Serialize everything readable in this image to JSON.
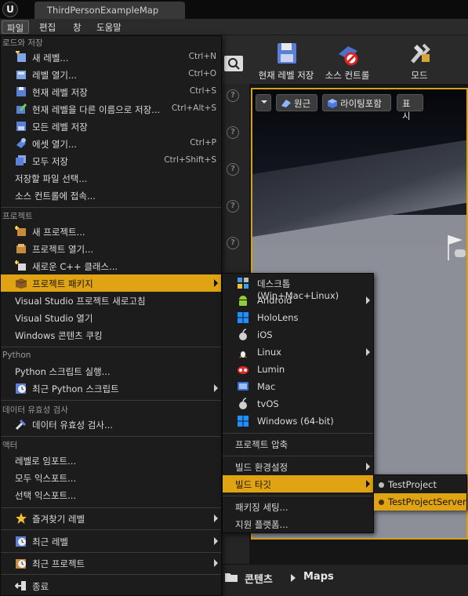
{
  "window": {
    "logo": "U",
    "tab_title": "ThirdPersonExampleMap"
  },
  "menubar": {
    "items": [
      "파일",
      "편집",
      "창",
      "도움말"
    ]
  },
  "toolbar": {
    "save_current_level": "현재 레벨 저장",
    "source_control": "소스 컨트롤",
    "modes": "모드"
  },
  "viewport_bar": {
    "perspective": "원근",
    "lit": "라이팅포함",
    "show": "표시"
  },
  "content_browser": {
    "content": "콘텐츠",
    "maps": "Maps"
  },
  "file_menu": {
    "sections": {
      "load_save": "로드와 저장",
      "project": "프로젝트",
      "python": "Python",
      "data_validation": "데이터 유효성 검사",
      "actor": "액터"
    },
    "items": {
      "new_level": {
        "label": "새 레벨...",
        "shortcut": "Ctrl+N"
      },
      "open_level": {
        "label": "레벨 열기...",
        "shortcut": "Ctrl+O"
      },
      "save_current": {
        "label": "현재 레벨 저장",
        "shortcut": "Ctrl+S"
      },
      "save_current_as": {
        "label": "현재 레벨을 다른 이름으로 저장...",
        "shortcut": "Ctrl+Alt+S"
      },
      "save_all_levels": {
        "label": "모든 레벨 저장"
      },
      "open_asset": {
        "label": "에셋 열기...",
        "shortcut": "Ctrl+P"
      },
      "save_all": {
        "label": "모두 저장",
        "shortcut": "Ctrl+Shift+S"
      },
      "choose_files_to_save": {
        "label": "저장할 파일 선택..."
      },
      "connect_source_control": {
        "label": "소스 컨트롤에 접속..."
      },
      "new_project": {
        "label": "새 프로젝트..."
      },
      "open_project": {
        "label": "프로젝트 열기..."
      },
      "new_cpp_class": {
        "label": "새로운 C++ 클래스..."
      },
      "package_project": {
        "label": "프로젝트 패키지"
      },
      "refresh_vs": {
        "label": "Visual Studio 프로젝트 새로고침"
      },
      "open_vs": {
        "label": "Visual Studio 열기"
      },
      "windows_cook": {
        "label": "Windows 콘텐츠 쿠킹"
      },
      "run_python": {
        "label": "Python 스크립트 실행..."
      },
      "recent_python": {
        "label": "최근 Python 스크립트"
      },
      "validate_data": {
        "label": "데이터 유효성 검사..."
      },
      "import_to_level": {
        "label": "레벨로 임포트..."
      },
      "export_all": {
        "label": "모두 익스포트..."
      },
      "export_selected": {
        "label": "선택 익스포트..."
      },
      "favorite_levels": {
        "label": "즐겨찾기 레벨"
      },
      "recent_levels": {
        "label": "최근 레벨"
      },
      "recent_projects": {
        "label": "최근 프로젝트"
      },
      "exit": {
        "label": "종료"
      }
    }
  },
  "package_menu": {
    "platforms": [
      "데스크톱 (Win+Mac+Linux)",
      "Android",
      "HoloLens",
      "iOS",
      "Linux",
      "Lumin",
      "Mac",
      "tvOS",
      "Windows (64-bit)"
    ],
    "zip_project": "프로젝트 압축",
    "build_config": "빌드 환경설정",
    "build_target": "빌드 타깃",
    "packaging_settings": "패키징 세팅...",
    "supported_platforms": "지원 플랫폼..."
  },
  "build_target_menu": {
    "items": [
      "TestProject",
      "TestProjectServer"
    ]
  },
  "colors": {
    "highlight": "#e0a311",
    "viewport_border": "#d6a11a"
  }
}
